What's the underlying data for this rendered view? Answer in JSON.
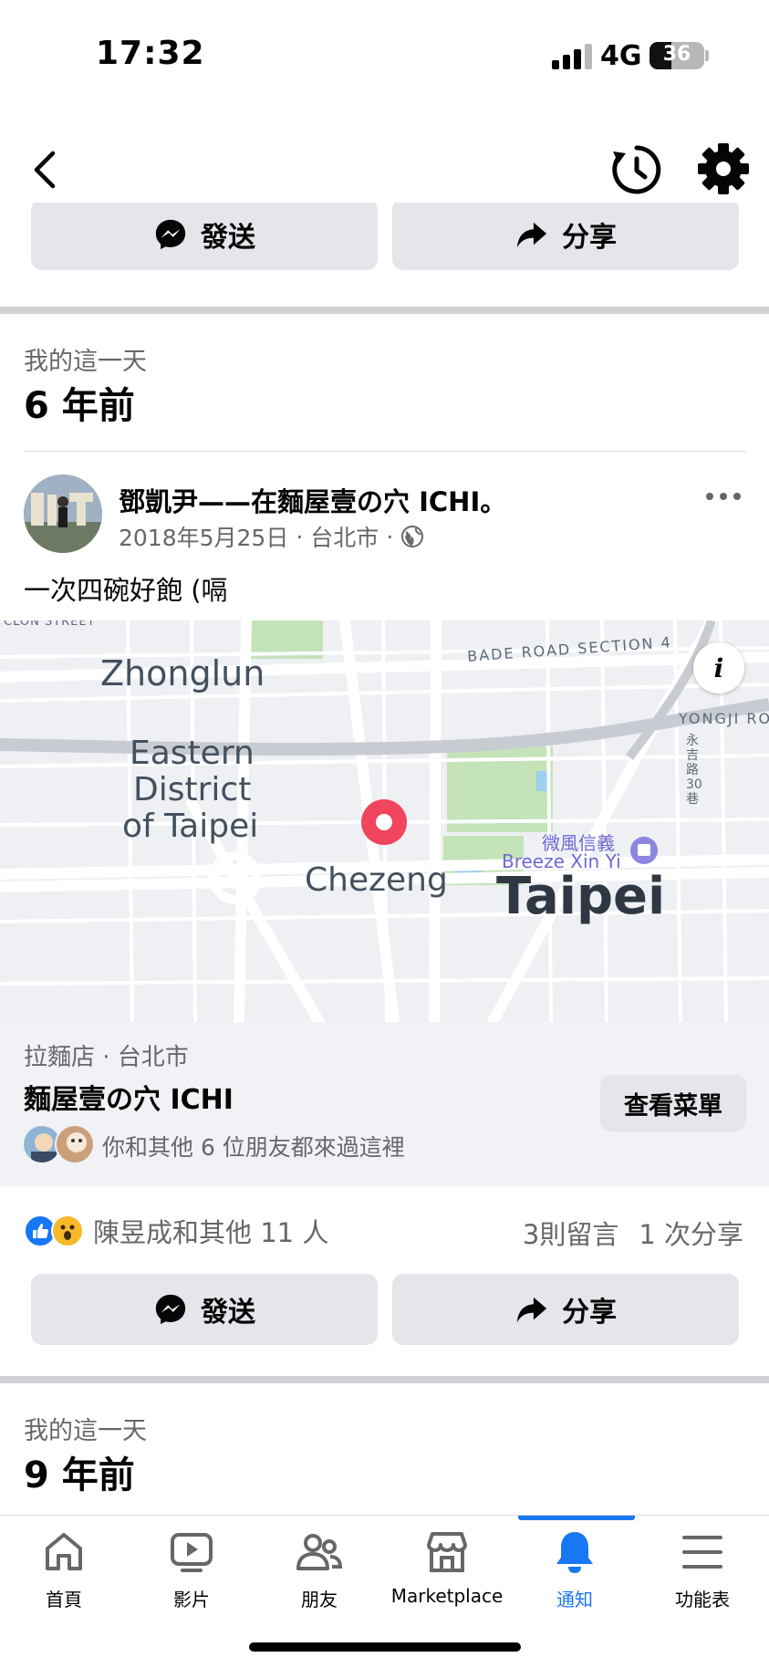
{
  "status_bar": {
    "time": "17:32",
    "network": "4G",
    "battery": "36"
  },
  "post_actions": {
    "send_label": "發送",
    "share_label": "分享"
  },
  "memory_1": {
    "subtitle": "我的這一天",
    "years_ago": "6 年前"
  },
  "post": {
    "author": "鄧凱尹——在麵屋壹の穴 ICHI。",
    "date": "2018年5月25日",
    "location": "台北市",
    "separator": "·",
    "text": "一次四碗好飽 (嗝"
  },
  "map": {
    "labels": {
      "street_top": "CLON STREET",
      "bade_road": "BADE ROAD SECTION 4",
      "zhonglun": "Zhonglun",
      "yongji": "YONGJI RO",
      "yongji_lane": "永吉路30巷",
      "eastern_line1": "Eastern",
      "eastern_line2": "District",
      "eastern_line3": "of Taipei",
      "breeze_cn": "微風信義",
      "breeze_en": "Breeze Xin Yi",
      "chezeng": "Chezeng",
      "taipei": "Taipei"
    },
    "info_label": "i",
    "pin_color": "#f0455c"
  },
  "place": {
    "category": "拉麵店 · 台北市",
    "name": "麵屋壹の穴 ICHI",
    "friends_text": "你和其他 6 位朋友都來過這裡",
    "menu_button": "查看菜單"
  },
  "engagement": {
    "reaction_names": "陳昱成和其他 11 人",
    "comments": "3則留言",
    "shares": "1 次分享"
  },
  "memory_2": {
    "subtitle": "我的這一天",
    "years_ago": "9 年前"
  },
  "tab_bar": {
    "tabs": [
      {
        "id": "home",
        "label": "首頁",
        "icon": "home-icon"
      },
      {
        "id": "video",
        "label": "影片",
        "icon": "video-icon"
      },
      {
        "id": "friends",
        "label": "朋友",
        "icon": "friends-icon"
      },
      {
        "id": "marketplace",
        "label": "Marketplace",
        "icon": "marketplace-icon"
      },
      {
        "id": "notifications",
        "label": "通知",
        "icon": "bell-icon"
      },
      {
        "id": "menu",
        "label": "功能表",
        "icon": "menu-icon"
      }
    ],
    "active": "notifications"
  },
  "colors": {
    "accent": "#1877f2",
    "button_bg": "#e4e6eb",
    "card_bg": "#f0f2f5",
    "text_secondary": "#65676b"
  }
}
